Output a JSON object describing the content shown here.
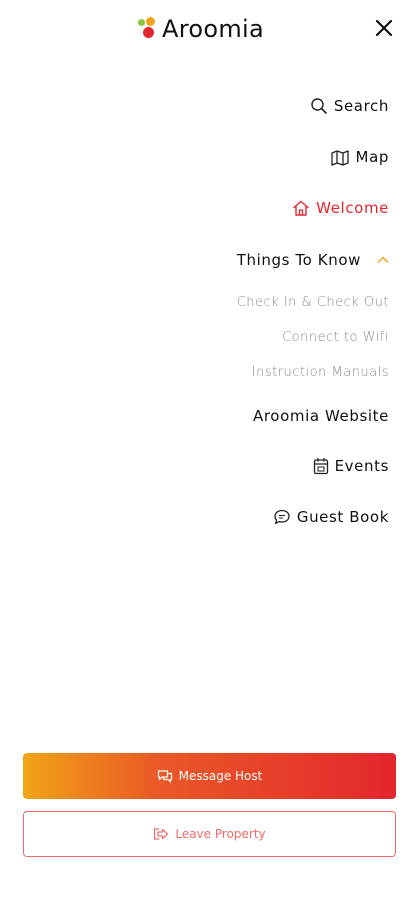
{
  "app": {
    "title": "Aroomia"
  },
  "menu": {
    "search": "Search",
    "map": "Map",
    "welcome": "Welcome",
    "things_to_know": "Things To Know",
    "sub_items": [
      "Check In & Check Out",
      "Connect to Wifi",
      "Instruction Manuals"
    ],
    "website": "Aroomia Website",
    "events": "Events",
    "guest_book": "Guest Book"
  },
  "buttons": {
    "message_host": "Message Host",
    "leave_property": "Leave Property"
  },
  "colors": {
    "accent_red": "#e3262c",
    "accent_orange": "#f2a516",
    "outline_red": "#f06a67"
  },
  "icons": [
    "logo-mark",
    "close-icon",
    "search-icon",
    "map-icon",
    "home-icon",
    "chevron-up-icon",
    "calendar-icon",
    "chat-icon",
    "messages-icon",
    "exit-icon"
  ]
}
